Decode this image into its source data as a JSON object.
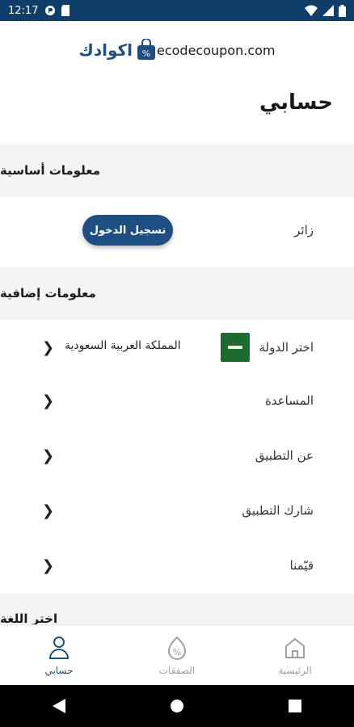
{
  "statusbar": {
    "time": "12:17"
  },
  "logo": {
    "text": "اكوادك",
    "sub": "ecodecoupon.com"
  },
  "page": {
    "title": "حسابي"
  },
  "basic_info": {
    "header": "معلومات أساسية",
    "visitor_label": "زائر",
    "login_button": "تسجيل الدخول"
  },
  "extra_info": {
    "header": "معلومات إضافية",
    "country_label": "اختر الدولة",
    "country_value": "المملكة العربية السعودية",
    "items": [
      "المساعدة",
      "عن التطبيق",
      "شارك التطبيق",
      "قيّمنا"
    ]
  },
  "language": {
    "header": "اختر اللغة"
  },
  "bottom_nav": {
    "home": "الرئيسية",
    "deals": "الصفقات",
    "account": "حسابي"
  },
  "colors": {
    "primary": "#1e4f83",
    "statusbar": "#0f3e6b",
    "section_bg": "#f4f4f4"
  }
}
